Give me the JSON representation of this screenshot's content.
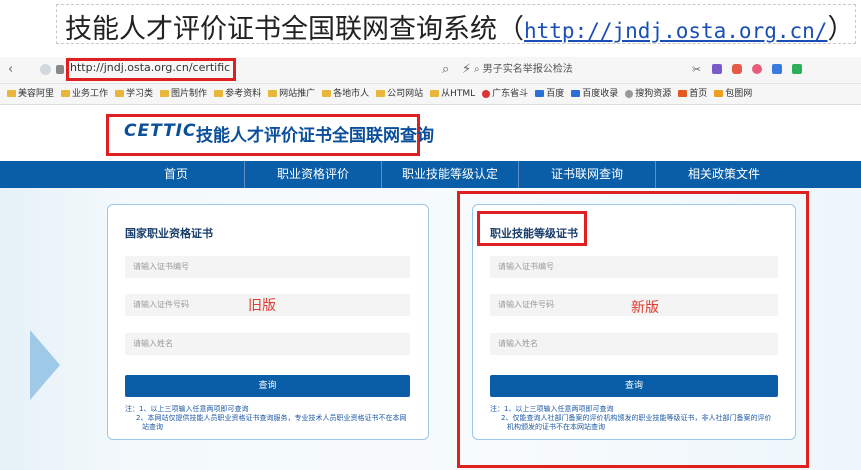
{
  "title": {
    "text": "技能人才评价证书全国联网查询系统（",
    "link": "http://jndj.osta.org.cn/",
    "close": "）"
  },
  "browser": {
    "url": "http://jndj.osta.org.cn/certificate",
    "search_text": "男子实名举报公检法",
    "bookmarks": [
      "美容阿里",
      "业务工作",
      "学习类",
      "图片制作",
      "参考资料",
      "网站推广",
      "各地市人",
      "公司网站",
      "从HTML",
      "广东省斗",
      "百度",
      "百度收录",
      "搜狗资源",
      "首页",
      "包图网"
    ]
  },
  "site": {
    "logo_mark": "CETTIC",
    "logo_title": "技能人才评价证书全国联网查询",
    "nav": [
      "首页",
      "职业资格评价",
      "职业技能等级认定",
      "证书联网查询",
      "相关政策文件"
    ]
  },
  "left_panel": {
    "title": "国家职业资格证书",
    "cert_placeholder": "请输入证书编号",
    "id_placeholder": "请输入证件号码",
    "name_placeholder": "请输入姓名",
    "button": "查询",
    "version_label": "旧版",
    "note1": "注：1、以上三项输入任意两项即可查询",
    "note2": "2、本网站仅提供技能人员职业资格证书查询服务，专业技术人员职业资格证书不在本网",
    "note3": "站查询"
  },
  "right_panel": {
    "title": "职业技能等级证书",
    "cert_placeholder": "请输入证书编号",
    "id_placeholder": "请输入证件号码",
    "name_placeholder": "请输入姓名",
    "button": "查询",
    "version_label": "新版",
    "note1": "注：1、以上三项输入任意两项即可查询",
    "note2": "2、仅能查询人社部门备案的评价机构颁发的职业技能等级证书，非人社部门备案的评价",
    "note3": "机构颁发的证书不在本网站查询"
  },
  "colors": {
    "nav": "#0a5ea8",
    "highlight": "#e02020",
    "panel_title": "#1b3f6b"
  }
}
